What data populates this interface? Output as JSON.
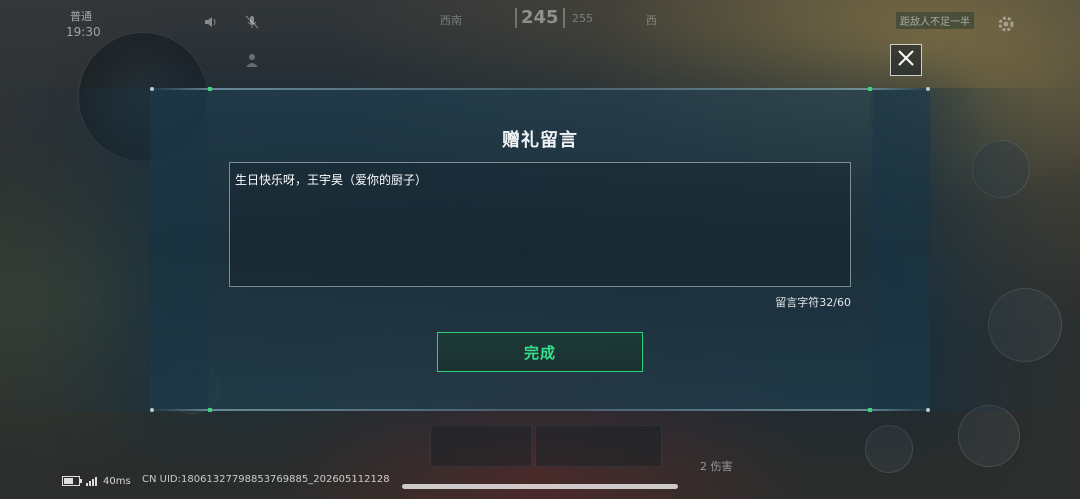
{
  "hud": {
    "mode_label": "普通",
    "clock": "19:30",
    "compass_left": "西南",
    "compass_heading": "245",
    "compass_next": "255",
    "compass_right": "西",
    "top_right_label": "距敌人不足一半",
    "kills_count": "2",
    "kills_label": "伤害"
  },
  "modal": {
    "title": "赠礼留言",
    "message_text": "生日快乐呀，王宇昊（爱你的厨子）",
    "char_count_label": "留言字符32/60",
    "done_label": "完成"
  },
  "status_bar": {
    "ping": "40ms",
    "uid": "CN UID:18061327798853769885_202605112128"
  },
  "colors": {
    "accent_green": "#36e08a",
    "panel_blue": "#1e3c4e"
  },
  "icons": {
    "close": "close-icon",
    "battery": "battery-icon",
    "signal": "signal-icon",
    "speaker": "speaker-icon",
    "mic": "mic-icon",
    "settings": "gear-icon"
  }
}
